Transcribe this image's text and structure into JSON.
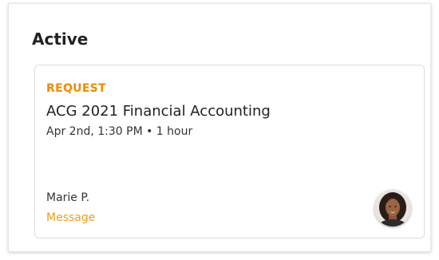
{
  "section": {
    "title": "Active"
  },
  "card": {
    "status": "REQUEST",
    "course": "ACG 2021 Financial Accounting",
    "schedule": "Apr 2nd, 1:30 PM • 1 hour",
    "tutor_name": "Marie P.",
    "message_label": "Message",
    "avatar_icon": "tutor-avatar-photo"
  },
  "colors": {
    "accent": "#f08a00",
    "link": "#f39c12",
    "text": "#222222"
  }
}
